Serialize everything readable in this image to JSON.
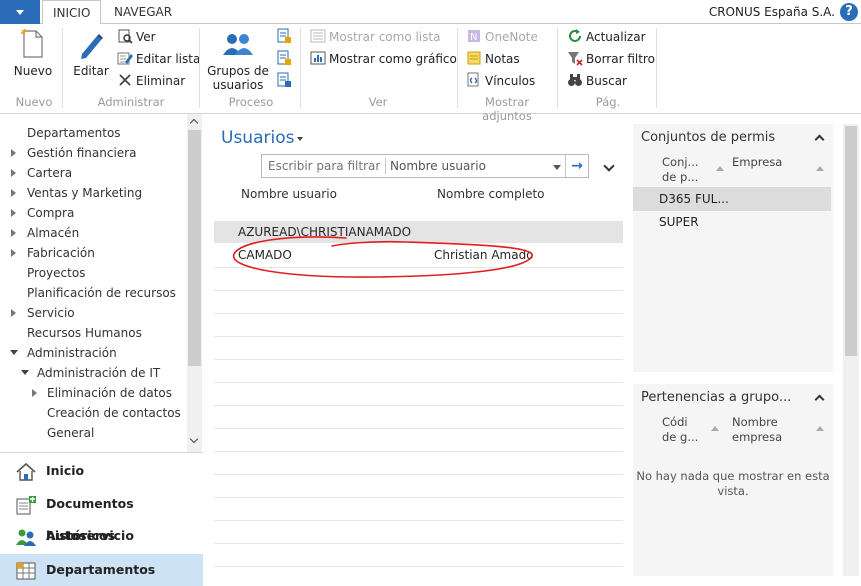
{
  "tabs": {
    "inicio": "INICIO",
    "navegar": "NAVEGAR"
  },
  "company": "CRONUS España S.A.",
  "help_glyph": "?",
  "ribbon": {
    "nuevo": {
      "button": "Nuevo",
      "group": "Nuevo"
    },
    "administrar": {
      "editar": "Editar",
      "ver": "Ver",
      "editar_lista": "Editar lista",
      "eliminar": "Eliminar",
      "group": "Administrar"
    },
    "proceso": {
      "grupos_l1": "Grupos de",
      "grupos_l2": "usuarios",
      "group": "Proceso"
    },
    "ver": {
      "mostrar_lista": "Mostrar como lista",
      "mostrar_grafico": "Mostrar como gráfico",
      "group": "Ver"
    },
    "adjuntos": {
      "onenote": "OneNote",
      "notas": "Notas",
      "vinculos": "Vínculos",
      "group": "Mostrar adjuntos"
    },
    "pag": {
      "actualizar": "Actualizar",
      "borrar_filtro": "Borrar filtro",
      "buscar": "Buscar",
      "group": "Pág."
    }
  },
  "nav": {
    "items": [
      {
        "label": "Departamentos",
        "expand": "none"
      },
      {
        "label": "Gestión financiera",
        "expand": "collapsed"
      },
      {
        "label": "Cartera",
        "expand": "collapsed"
      },
      {
        "label": "Ventas y Marketing",
        "expand": "collapsed"
      },
      {
        "label": "Compra",
        "expand": "collapsed"
      },
      {
        "label": "Almacén",
        "expand": "collapsed"
      },
      {
        "label": "Fabricación",
        "expand": "collapsed"
      },
      {
        "label": "Proyectos",
        "expand": "none"
      },
      {
        "label": "Planificación de recursos",
        "expand": "none"
      },
      {
        "label": "Servicio",
        "expand": "collapsed"
      },
      {
        "label": "Recursos Humanos",
        "expand": "none"
      },
      {
        "label": "Administración",
        "expand": "expanded"
      },
      {
        "label": "Administración de IT",
        "expand": "expanded"
      },
      {
        "label": "Eliminación de datos",
        "expand": "collapsed"
      },
      {
        "label": "Creación de contactos",
        "expand": "none"
      },
      {
        "label": "General",
        "expand": "none"
      }
    ]
  },
  "navbottom": [
    {
      "label": "Inicio",
      "icon": "house-icon",
      "selected": false
    },
    {
      "label": "Documentos históricos",
      "icon": "posted-documents-icon",
      "selected": false
    },
    {
      "label": "Autoservicio",
      "icon": "self-service-icon",
      "selected": false
    },
    {
      "label": "Departamentos",
      "icon": "departments-icon",
      "selected": true
    }
  ],
  "main": {
    "title": "Usuarios",
    "filter_placeholder": "Escribir para filtrar (",
    "filter_field": "Nombre usuario",
    "filter_go": "→",
    "columns": [
      "Nombre usuario",
      "Nombre completo"
    ],
    "rows": [
      {
        "username": "AZUREAD\\CHRISTIANAMADO",
        "fullname": ""
      },
      {
        "username": "CAMADO",
        "fullname": "Christian Amado"
      }
    ]
  },
  "factbox_permisos": {
    "title": "Conjuntos de permis",
    "col1_l1": "Conj...",
    "col1_l2": "de p...",
    "col2": "Empresa",
    "rows": [
      "D365 FUL...",
      "SUPER"
    ]
  },
  "factbox_grupos": {
    "title": "Pertenencias a grupo...",
    "col1_l1": "Códi",
    "col1_l2": "de g...",
    "col2_l1": "Nombre",
    "col2_l2": "empresa",
    "empty_l1": "No hay nada que mostrar en esta",
    "empty_l2": "vista."
  },
  "colors": {
    "accent": "#2b6cb8",
    "annotation": "#e02020",
    "selection": "#cde3f5"
  }
}
